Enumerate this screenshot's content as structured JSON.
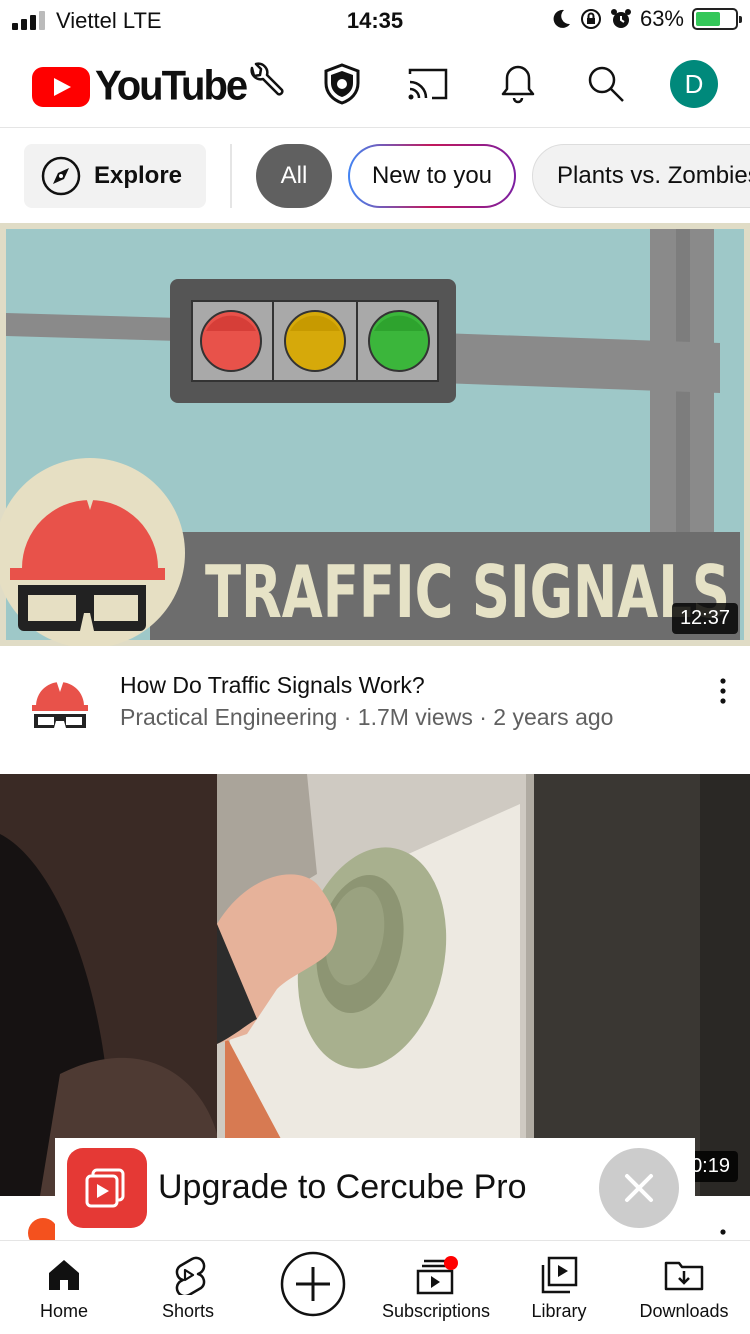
{
  "status_bar": {
    "carrier": "Viettel  LTE",
    "time": "14:35",
    "battery": "63%",
    "battery_level": 0.63
  },
  "header": {
    "logo_text": "YouTube",
    "avatar_letter": "D",
    "icons": [
      "wrench-icon",
      "shield-icon",
      "cast-icon",
      "bell-icon",
      "search-icon"
    ]
  },
  "chips": {
    "explore": "Explore",
    "all": "All",
    "new_to_you": "New to you",
    "plants": "Plants vs. Zombies"
  },
  "videos": [
    {
      "thumbnail_text": "TRAFFIC SIGNALS",
      "duration": "12:37",
      "title": "How Do Traffic Signals Work?",
      "meta": "Practical Engineering · 1.7M views · 2 years ago"
    },
    {
      "duration": "0:19"
    }
  ],
  "promo": {
    "label": "Upgrade to Cercube Pro"
  },
  "bottom_nav": {
    "home": "Home",
    "shorts": "Shorts",
    "subscriptions": "Subscriptions",
    "library": "Library",
    "downloads": "Downloads"
  },
  "colors": {
    "brand_red": "#ff0000",
    "avatar_bg": "#00897b",
    "chip_selected": "#606060",
    "notification_dot": "#ff0000"
  }
}
